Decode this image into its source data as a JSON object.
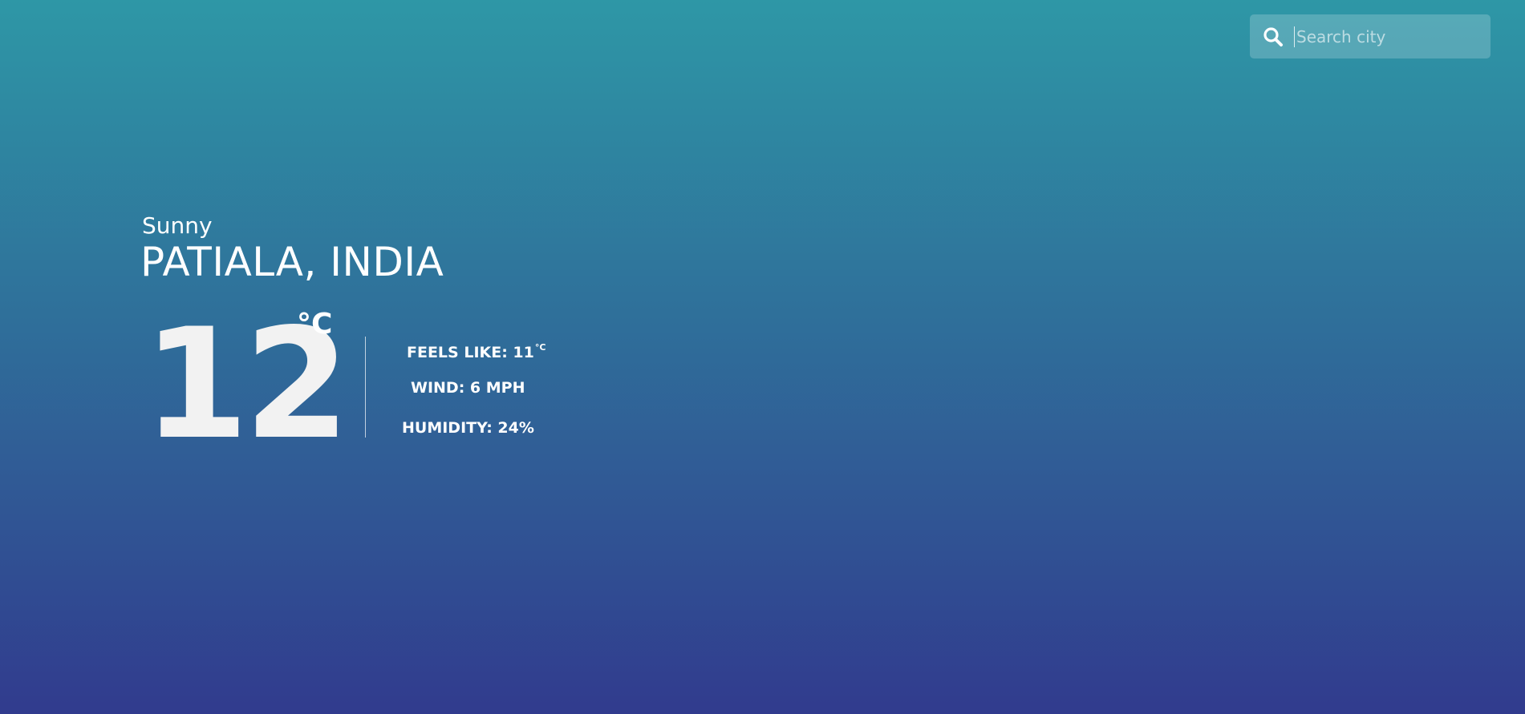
{
  "search": {
    "placeholder": "Search city",
    "value": "",
    "icon": "search-icon"
  },
  "weather": {
    "condition": "Sunny",
    "location": "PATIALA, INDIA",
    "temperature": "12",
    "temperature_unit": "°C",
    "feels_like_label": "FEELS LIKE: 11",
    "feels_like_unit": "°C",
    "wind_label": "WIND: 6 MPH",
    "humidity_label": "HUMIDITY: 24%"
  },
  "colors": {
    "gradient_top": "#2e97a6",
    "gradient_bottom": "#313b8e",
    "text": "#ffffff"
  }
}
